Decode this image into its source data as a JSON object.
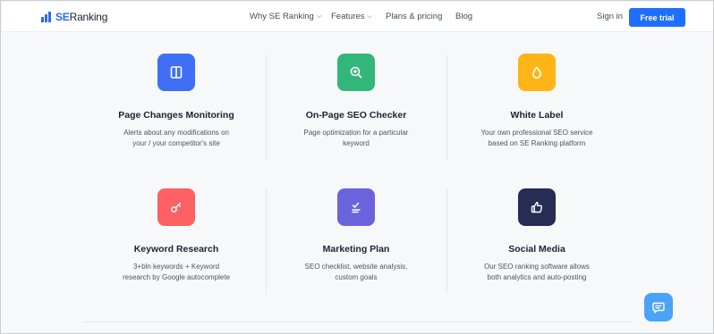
{
  "header": {
    "logo": {
      "se": "SE",
      "ranking": "Ranking"
    },
    "nav": [
      {
        "label": "Why SE Ranking",
        "has_dropdown": true
      },
      {
        "label": "Features",
        "has_dropdown": true
      },
      {
        "label": "Plans & pricing",
        "has_dropdown": false
      },
      {
        "label": "Blog",
        "has_dropdown": false
      }
    ],
    "sign_in": "Sign in",
    "cta": "Free trial"
  },
  "features": [
    {
      "title": "Page Changes Monitoring",
      "desc": [
        "Alerts about any modifications on",
        "your / your competitor's site"
      ],
      "icon": "page-split-icon",
      "color": "#3f6ff5"
    },
    {
      "title": "On-Page SEO Checker",
      "desc": [
        "Page optimization for a particular",
        "keyword"
      ],
      "icon": "magnifier-plus-icon",
      "color": "#33b679"
    },
    {
      "title": "White Label",
      "desc": [
        "Your own professional SEO service",
        "based on SE Ranking platform"
      ],
      "icon": "droplet-icon",
      "color": "#ffb516"
    },
    {
      "title": "Keyword Research",
      "desc": [
        "3+bln keywords + Keyword",
        "research by Google autocomplete"
      ],
      "icon": "key-icon",
      "color": "#fc6163"
    },
    {
      "title": "Marketing Plan",
      "desc": [
        "SEO checklist, website analysis,",
        "custom goals"
      ],
      "icon": "checklist-icon",
      "color": "#6b63de"
    },
    {
      "title": "Social Media",
      "desc": [
        "Our SEO ranking software allows",
        "both analytics and auto-posting"
      ],
      "icon": "thumbs-up-icon",
      "color": "#262c53"
    }
  ],
  "chat": {
    "icon": "chat-bubble-icon",
    "color": "#4aa3f7"
  }
}
